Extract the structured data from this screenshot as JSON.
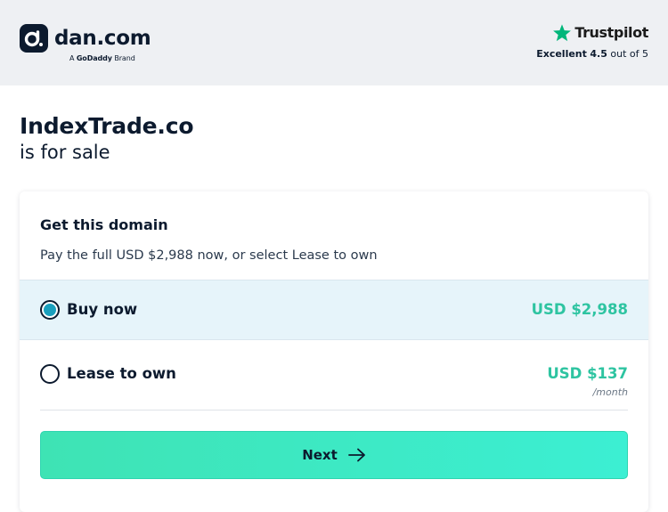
{
  "header": {
    "logo_text": "dan.com",
    "brand_prefix": "A",
    "brand_name": "GoDaddy",
    "brand_suffix": "Brand",
    "trustpilot": {
      "name": "Trustpilot",
      "rating_label": "Excellent",
      "rating_value": "4.5",
      "rating_suffix": "out of 5",
      "star_color": "#00b67a"
    }
  },
  "listing": {
    "domain": "IndexTrade.co",
    "status": "is for sale"
  },
  "purchase_card": {
    "title": "Get this domain",
    "description": "Pay the full USD $2,988 now, or select Lease to own",
    "options": [
      {
        "label": "Buy now",
        "price": "USD $2,988",
        "period": "",
        "selected": true
      },
      {
        "label": "Lease to own",
        "price": "USD $137",
        "period": "/month",
        "selected": false
      }
    ],
    "next_label": "Next"
  },
  "colors": {
    "accent_price": "#2ec4a1",
    "selected_bg": "#e6f4fa",
    "radio_fill": "#1a9fbd",
    "button_gradient_start": "#3ee3b4",
    "button_gradient_end": "#3cefd3",
    "text_dark": "#0c1a2e"
  },
  "icons": {
    "logo": "dan-logo-icon",
    "trustpilot": "star-icon",
    "next": "arrow-right-icon"
  }
}
